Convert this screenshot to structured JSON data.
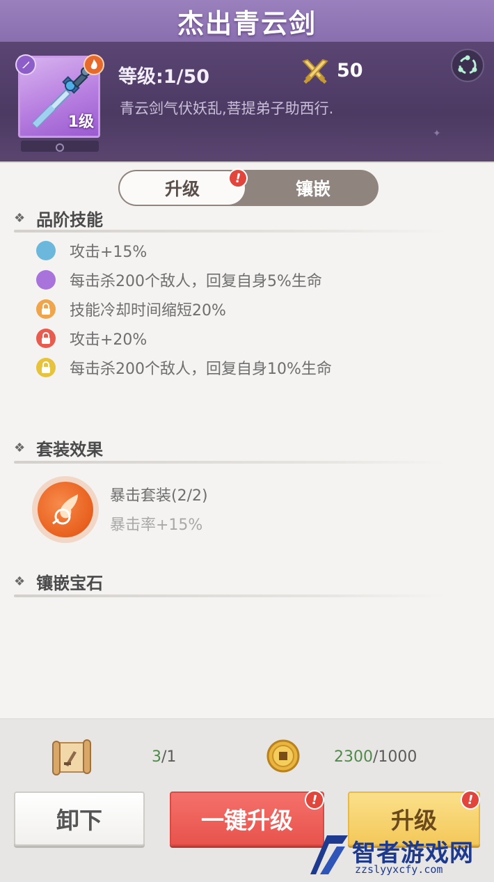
{
  "header": {
    "title": "杰出青云剑",
    "level_text": "等级:1/50",
    "power": "50",
    "description": "青云剑气伏妖乱,菩提弟子助西行.",
    "item_level_tag": "1级"
  },
  "tabs": {
    "upgrade": "升级",
    "inlay": "镶嵌",
    "alert": "!"
  },
  "sections": {
    "quality_skills": {
      "title": "品阶技能",
      "items": [
        {
          "text": "攻击+15%",
          "color": "#6cb8dc"
        },
        {
          "text": "每击杀200个敌人，回复自身5%生命",
          "color": "#a874dc"
        },
        {
          "text": "技能冷却时间缩短20%",
          "color": "#f0a54a"
        },
        {
          "text": "攻击+20%",
          "color": "#e85b4f"
        },
        {
          "text": "每击杀200个敌人，回复自身10%生命",
          "color": "#e6c33a"
        }
      ]
    },
    "set_effect": {
      "title": "套装效果",
      "name": "暴击套装(2/2)",
      "effect": "暴击率+15%"
    },
    "gems": {
      "title": "镶嵌宝石"
    }
  },
  "resources": {
    "scroll_have": "3",
    "scroll_need": "/1",
    "coin_have": "2300",
    "coin_need": "/1000"
  },
  "buttons": {
    "unequip": "卸下",
    "one_click": "一键升级",
    "upgrade": "升级",
    "alert": "!"
  },
  "watermark": {
    "title": "智者游戏网",
    "url": "zzslyyxcfy.com"
  }
}
